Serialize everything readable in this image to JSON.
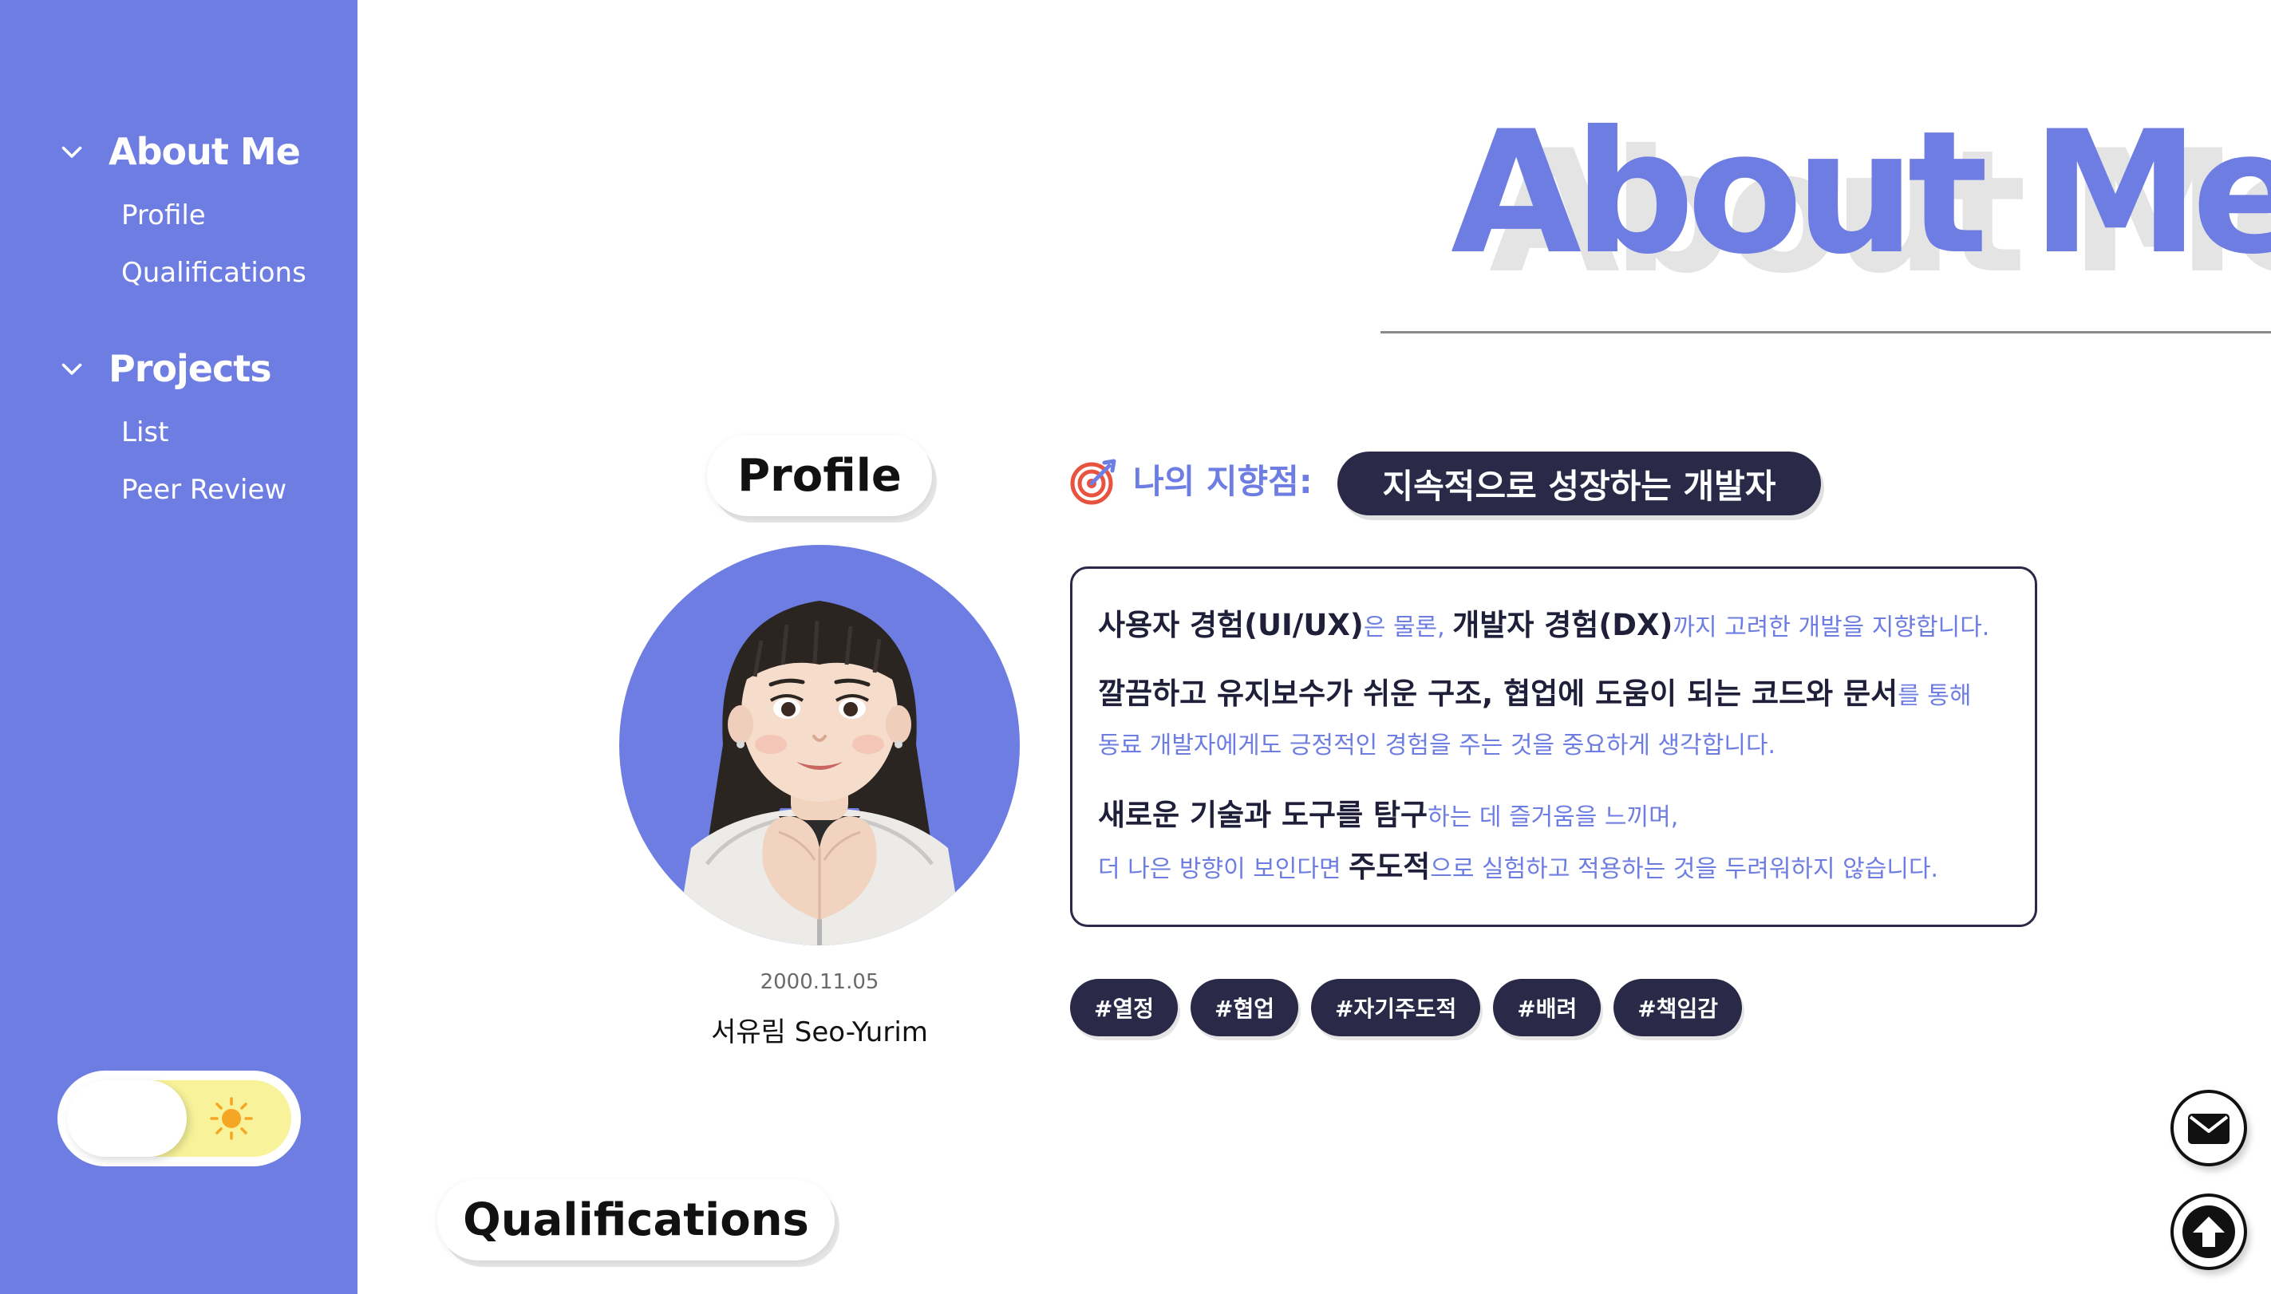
{
  "sidebar": {
    "groups": [
      {
        "title": "About Me",
        "items": [
          "Profile",
          "Qualifications"
        ]
      },
      {
        "title": "Projects",
        "items": [
          "List",
          "Peer Review"
        ]
      }
    ],
    "theme_toggle": {
      "mode": "light",
      "icon": "sun-icon"
    }
  },
  "header": {
    "title": "About Me",
    "shadow_title": "About Me"
  },
  "sections": {
    "profile_label": "Profile",
    "qualifications_label": "Qualifications"
  },
  "profile": {
    "birthdate": "2000.11.05",
    "name": "서유림 Seo-Yurim",
    "avatar": "memoji-avatar"
  },
  "goal": {
    "icon": "target-icon",
    "label": "나의 지향점:",
    "value": "지속적으로 성장하는 개발자"
  },
  "description": {
    "line1_strong_a": "사용자 경험(UI/UX)",
    "line1_soft_a": "은 물론, ",
    "line1_strong_b": "개발자 경험(DX)",
    "line1_soft_b": "까지 고려한 개발을 지향합니다.",
    "line2_strong_a": "깔끔하고 유지보수가 쉬운 구조, 협업에 도움이 되는 코드와 문서",
    "line2_soft_a": "를 통해",
    "line3_soft": "동료 개발자에게도 긍정적인 경험을 주는 것을 중요하게 생각합니다.",
    "line4_strong": "새로운 기술과 도구를 탐구",
    "line4_soft": "하는 데 즐거움을 느끼며,",
    "line5_soft_a": "더 나은 방향이 보인다면 ",
    "line5_strong": "주도적",
    "line5_soft_b": "으로 실험하고 적용하는 것을 두려워하지 않습니다."
  },
  "tags": [
    "#열정",
    "#협업",
    "#자기주도적",
    "#배려",
    "#책임감"
  ],
  "floating": {
    "mail_icon": "mail-icon",
    "top_icon": "arrow-up-icon"
  },
  "colors": {
    "accent": "#6e7de2",
    "dark_pill": "#2a2a48",
    "toggle_track": "#f8f39a",
    "sun": "#f5a623",
    "target": "#e8533f"
  }
}
